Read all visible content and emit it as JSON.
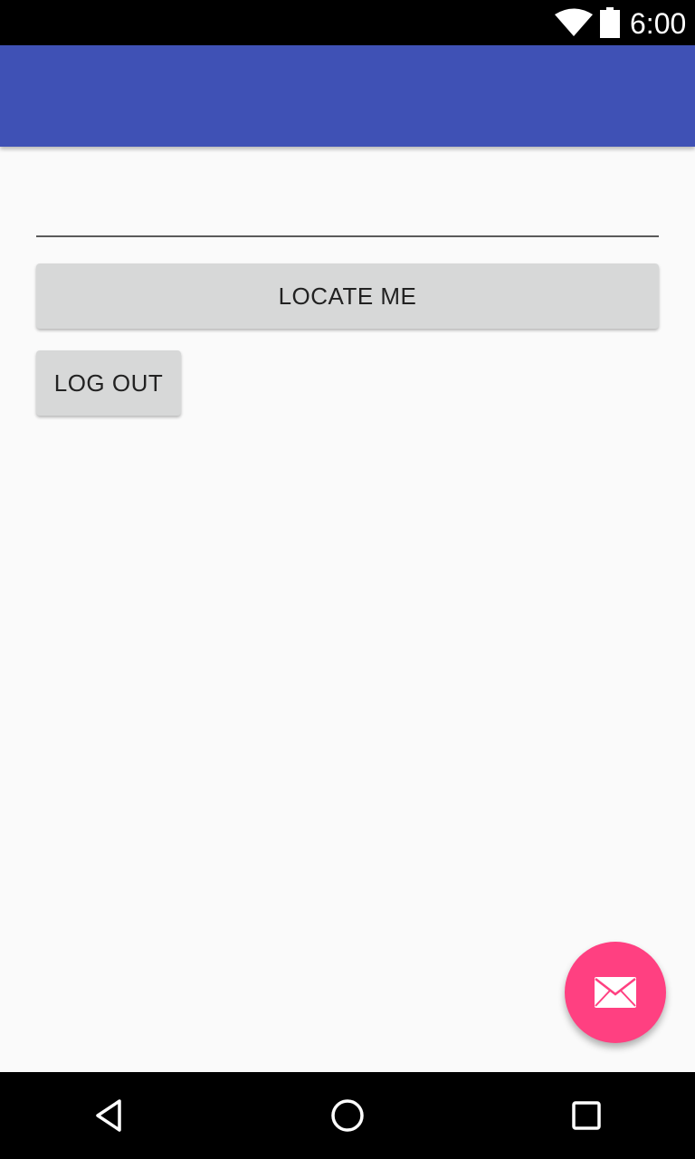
{
  "status_bar": {
    "time": "6:00",
    "icons": [
      "wifi-icon",
      "battery-icon"
    ]
  },
  "app_bar": {
    "color": "#3f51b5"
  },
  "form": {
    "input_value": "",
    "input_placeholder": "",
    "locate_button_label": "LOCATE ME",
    "logout_button_label": "LOG OUT"
  },
  "fab": {
    "icon": "mail-icon",
    "color": "#ff4081"
  },
  "nav_bar": {
    "icons": [
      "back-icon",
      "home-icon",
      "recents-icon"
    ]
  }
}
